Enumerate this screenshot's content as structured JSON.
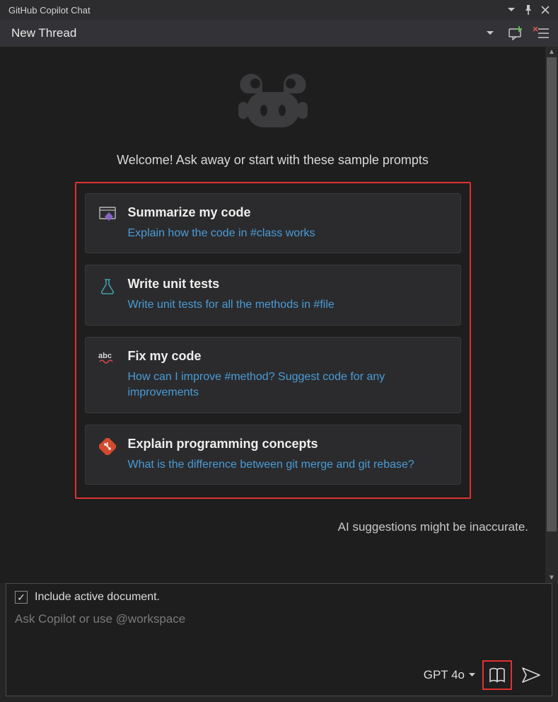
{
  "titlebar": {
    "title": "GitHub Copilot Chat"
  },
  "toolbar": {
    "thread_label": "New Thread"
  },
  "welcome": "Welcome! Ask away or start with these sample prompts",
  "prompts": [
    {
      "title": "Summarize my code",
      "subtitle": "Explain how the code in #class works"
    },
    {
      "title": "Write unit tests",
      "subtitle": "Write unit tests for all the methods in #file"
    },
    {
      "title": "Fix my code",
      "subtitle": "How can I improve #method? Suggest code for any improvements"
    },
    {
      "title": "Explain programming concepts",
      "subtitle": "What is the difference between git merge and git rebase?"
    }
  ],
  "notice": "AI suggestions might be inaccurate.",
  "input": {
    "checkbox_label": "Include active document.",
    "checkbox_checked": true,
    "placeholder": "Ask Copilot or use @workspace",
    "model": "GPT 4o"
  }
}
